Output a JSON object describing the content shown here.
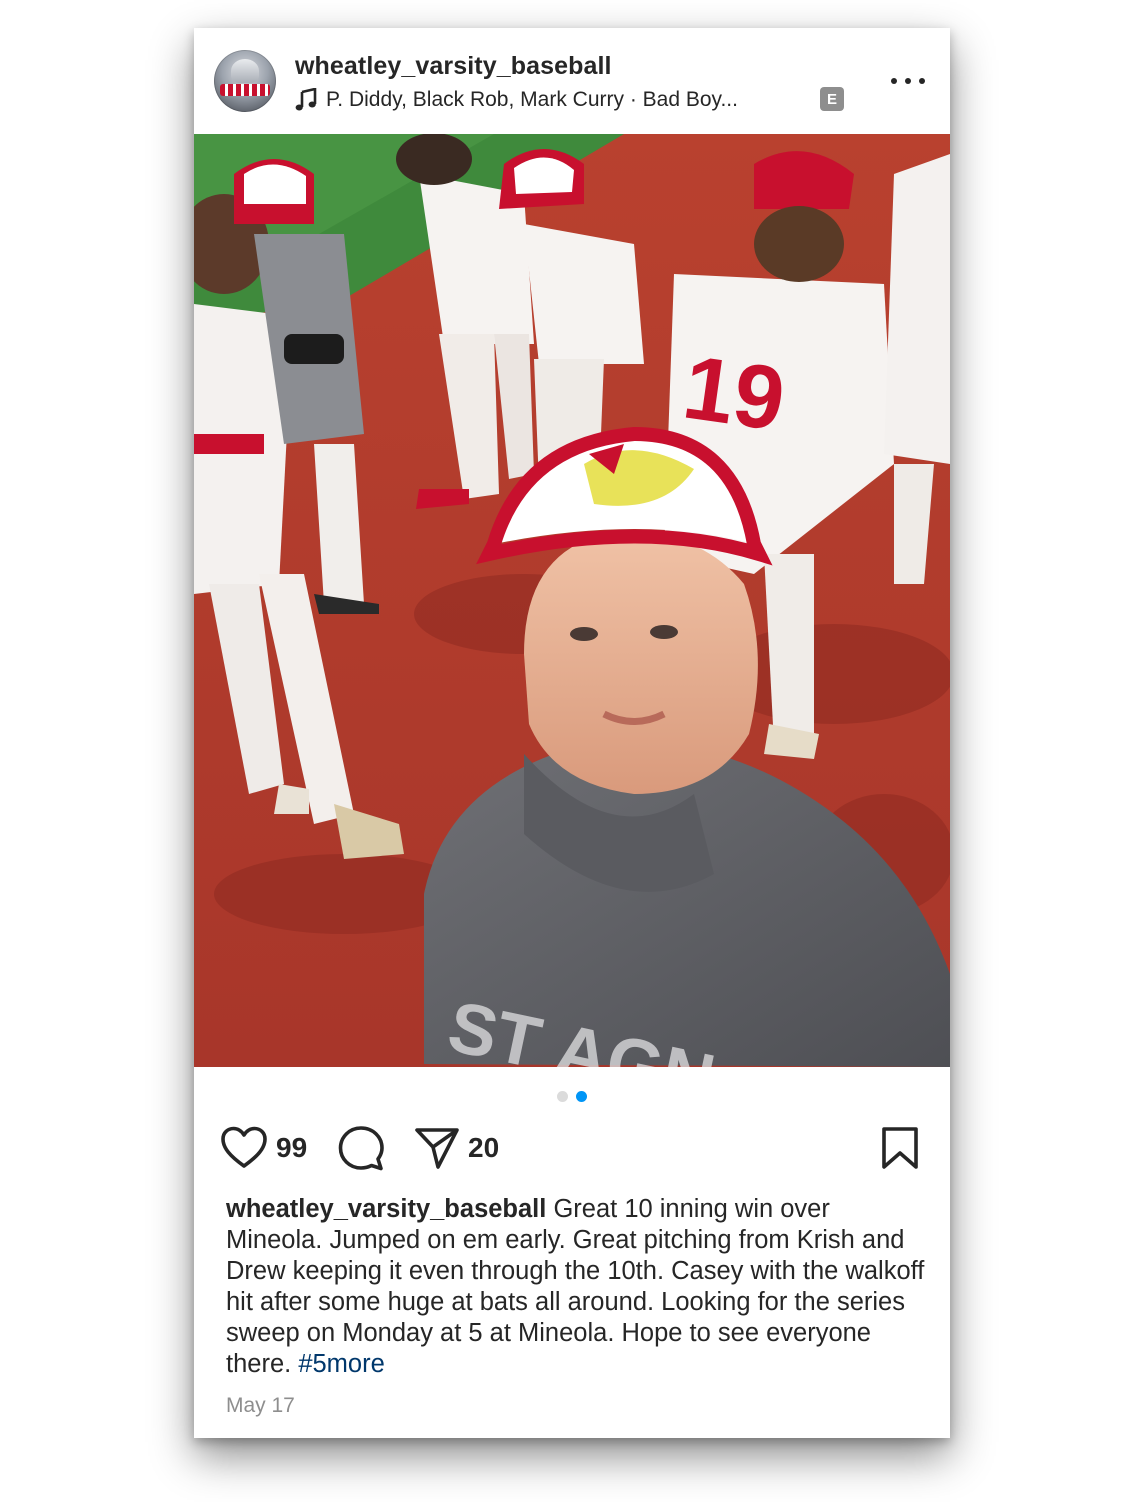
{
  "post": {
    "username": "wheatley_varsity_baseball",
    "music": {
      "icon": "music-note-icon",
      "text": "P. Diddy, Black Rob, Mark Curry · Bad Boy...",
      "explicit_badge": "E"
    },
    "more_icon": "more-options-icon",
    "media": {
      "description_icons": [
        "sound-icon"
      ],
      "carousel": {
        "count": 2,
        "active_index": 1
      }
    },
    "actions": {
      "likes": "99",
      "shares": "20"
    },
    "caption": {
      "username": "wheatley_varsity_baseball",
      "text": "Great 10 inning win over Mineola. Jumped on em early. Great pitching from Krish and Drew keeping it even through the 10th. Casey with the walkoff hit after some huge at bats all around. Looking for the series sweep on Monday at 5 at Mineola. Hope to see everyone there.",
      "more_link": "#5more"
    },
    "date": "May 17"
  },
  "colors": {
    "text": "#262626",
    "muted": "#8e8e8e",
    "link": "#00376b",
    "active_dot": "#0095f6"
  }
}
